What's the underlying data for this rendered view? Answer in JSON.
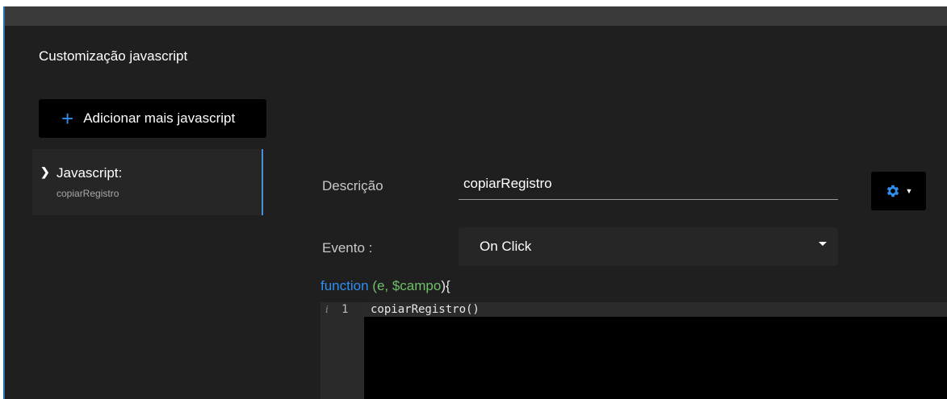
{
  "panel": {
    "title": "Customização javascript"
  },
  "add_button": {
    "icon": "plus-icon",
    "label": "Adicionar mais javascript"
  },
  "script_list": [
    {
      "label": "Javascript:",
      "subtitle": "copiarRegistro"
    }
  ],
  "form": {
    "descricao_label": "Descrição",
    "descricao_value": "copiarRegistro",
    "evento_label": "Evento :",
    "evento_value": "On Click"
  },
  "settings_button": {
    "icon": "gear-icon",
    "caret_icon": "caret-down-icon"
  },
  "code": {
    "keyword": "function",
    "params": "(e, $campo",
    "brace": "){",
    "gutter_info": "i",
    "line_number": "1",
    "line_text": "copiarRegistro()"
  },
  "colors": {
    "accent": "#2f8ef0",
    "params": "#6fbf6a",
    "panel_bg": "#1f1f1f"
  }
}
